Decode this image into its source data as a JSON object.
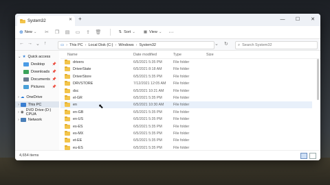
{
  "window": {
    "tab_title": "System32",
    "tab_close": "✕",
    "new_tab": "+",
    "controls": {
      "minimize": "—",
      "maximize": "☐",
      "close": "✕"
    }
  },
  "toolbar": {
    "new_label": "New",
    "sort_label": "Sort",
    "view_label": "View",
    "more_label": "···"
  },
  "address": {
    "crumbs": [
      "This PC",
      "Local Disk (C:)",
      "Windows",
      "System32"
    ],
    "search_placeholder": "Search System32"
  },
  "nav": {
    "quick_access": "Quick access",
    "desktop": "Desktop",
    "downloads": "Downloads",
    "documents": "Documents",
    "pictures": "Pictures",
    "onedrive": "OneDrive",
    "this_pc": "This PC",
    "dvd": "DVD Drive (D:) CPUA",
    "network": "Network"
  },
  "columns": {
    "name": "Name",
    "date": "Date modified",
    "type": "Type",
    "size": "Size"
  },
  "files": [
    {
      "name": "drivers",
      "date": "6/5/2021 5:35 PM",
      "type": "File folder"
    },
    {
      "name": "DriverState",
      "date": "6/5/2021 8:18 AM",
      "type": "File folder"
    },
    {
      "name": "DriverStore",
      "date": "6/5/2021 5:35 PM",
      "type": "File folder"
    },
    {
      "name": "DRVSTORE",
      "date": "7/12/2021 12:05 AM",
      "type": "File folder"
    },
    {
      "name": "dsc",
      "date": "6/5/2021 10:21 AM",
      "type": "File folder"
    },
    {
      "name": "el-GR",
      "date": "6/5/2021 5:35 PM",
      "type": "File folder"
    },
    {
      "name": "en",
      "date": "6/5/2021 10:30 AM",
      "type": "File folder"
    },
    {
      "name": "en-GB",
      "date": "6/5/2021 5:35 PM",
      "type": "File folder"
    },
    {
      "name": "en-US",
      "date": "6/5/2021 5:35 PM",
      "type": "File folder"
    },
    {
      "name": "es-ES",
      "date": "6/5/2021 5:35 PM",
      "type": "File folder"
    },
    {
      "name": "es-MX",
      "date": "6/5/2021 5:35 PM",
      "type": "File folder"
    },
    {
      "name": "et-EE",
      "date": "6/5/2021 5:35 PM",
      "type": "File folder"
    },
    {
      "name": "eu-ES",
      "date": "6/5/2021 5:35 PM",
      "type": "File folder"
    }
  ],
  "status": {
    "count": "4,654 items"
  }
}
